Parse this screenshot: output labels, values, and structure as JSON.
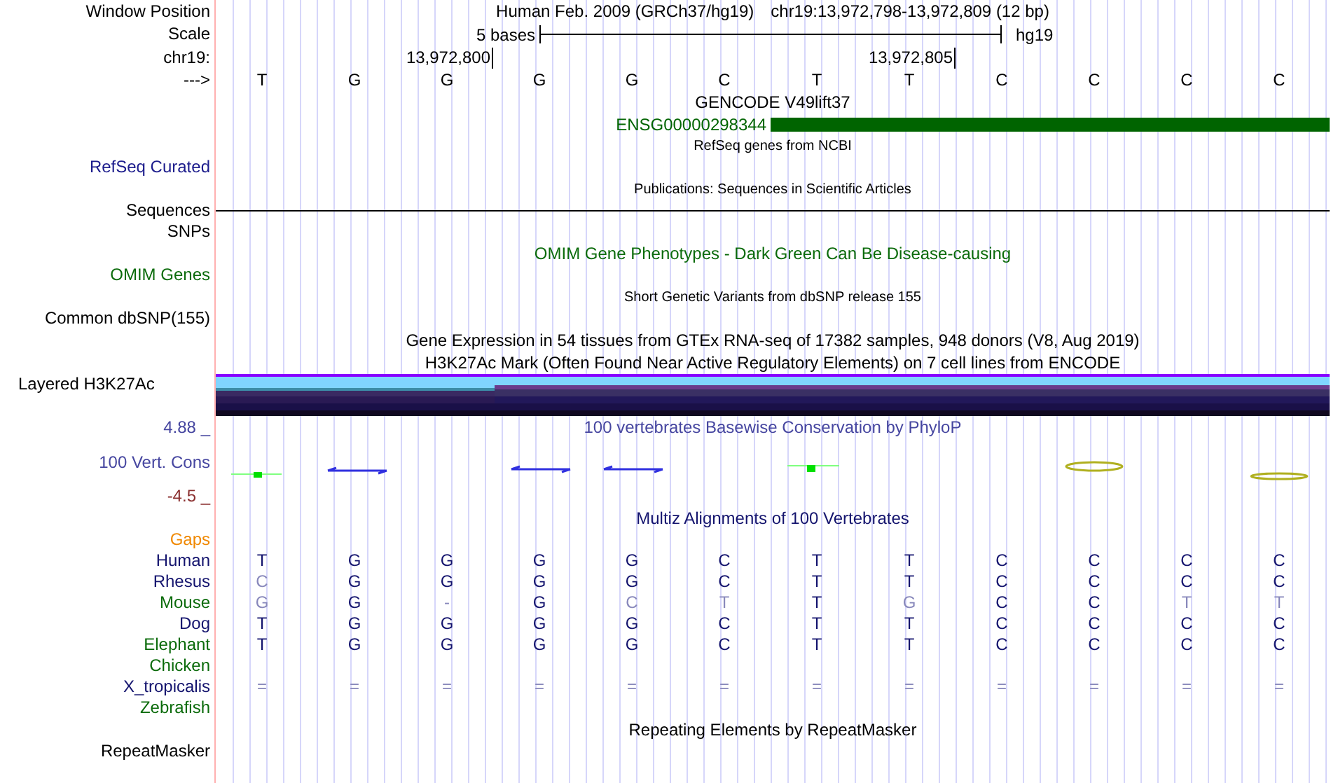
{
  "rows": [
    {
      "kind": "header",
      "label": "Window Position",
      "assembly": "Human Feb. 2009 (GRCh37/hg19)",
      "position": "chr19:13,972,798-13,972,809 (12 bp)"
    },
    {
      "kind": "scale",
      "label": "Scale",
      "span": "5 bases",
      "db": "hg19"
    },
    {
      "kind": "ruler",
      "label": "chr19:",
      "ticks": [
        "13,972,800",
        "13,972,805"
      ]
    },
    {
      "kind": "bases",
      "label": "--->",
      "bases": [
        "T",
        "G",
        "G",
        "G",
        "G",
        "C",
        "T",
        "T",
        "C",
        "C",
        "C",
        "C"
      ]
    },
    {
      "kind": "title",
      "text": "GENCODE V49lift37",
      "color": "#000000"
    },
    {
      "kind": "gene",
      "name": "ENSG00000298344",
      "color": "#006400"
    },
    {
      "kind": "small-title",
      "text": "RefSeq genes from NCBI"
    },
    {
      "kind": "label",
      "label": "RefSeq Curated",
      "color": "#1c1c8c"
    },
    {
      "kind": "small-title",
      "text": "Publications: Sequences in Scientific Articles"
    },
    {
      "kind": "rule",
      "label": "Sequences",
      "color": "#000000"
    },
    {
      "kind": "label",
      "label": "SNPs",
      "color": "#000000"
    },
    {
      "kind": "title",
      "text": "OMIM Gene Phenotypes - Dark Green Can Be Disease-causing",
      "color": "#0b6b0b"
    },
    {
      "kind": "label",
      "label": "OMIM Genes",
      "color": "#0b6b0b"
    },
    {
      "kind": "small-title",
      "text": "Short Genetic Variants from dbSNP release 155"
    },
    {
      "kind": "label",
      "label": "Common dbSNP(155)",
      "color": "#000000"
    },
    {
      "kind": "title",
      "text": "Gene Expression in 54 tissues from GTEx RNA-seq of 17382 samples, 948 donors (V8, Aug 2019)",
      "color": "#000000"
    },
    {
      "kind": "title",
      "text": "H3K27Ac Mark (Often Found Near Active Regulatory Elements) on 7 cell lines from ENCODE",
      "color": "#000000"
    },
    {
      "kind": "layered",
      "label": "Layered H3K27Ac",
      "color": "#000000"
    },
    {
      "kind": "title",
      "label": "4.88 _",
      "text": "100 vertebrates Basewise Conservation by PhyloP",
      "color": "#4646a0"
    },
    {
      "kind": "wiggle",
      "label": "100 Vert. Cons",
      "color": "#4646a0"
    },
    {
      "kind": "label",
      "label": "-4.5 _",
      "color": "#8b3030"
    },
    {
      "kind": "title",
      "text": "Multiz Alignments of 100 Vertebrates",
      "color": "#14146e"
    },
    {
      "kind": "label",
      "label": "Gaps",
      "color": "#f08800"
    },
    {
      "kind": "align",
      "label": "Human",
      "color": "#14146e",
      "bases": [
        {
          "text": "T",
          "dim": false
        },
        {
          "text": "G",
          "dim": false
        },
        {
          "text": "G",
          "dim": false
        },
        {
          "text": "G",
          "dim": false
        },
        {
          "text": "G",
          "dim": false
        },
        {
          "text": "C",
          "dim": false
        },
        {
          "text": "T",
          "dim": false
        },
        {
          "text": "T",
          "dim": false
        },
        {
          "text": "C",
          "dim": false
        },
        {
          "text": "C",
          "dim": false
        },
        {
          "text": "C",
          "dim": false
        },
        {
          "text": "C",
          "dim": false
        }
      ]
    },
    {
      "kind": "align",
      "label": "Rhesus",
      "color": "#14146e",
      "bases": [
        {
          "text": "C",
          "dim": true
        },
        {
          "text": "G",
          "dim": false
        },
        {
          "text": "G",
          "dim": false
        },
        {
          "text": "G",
          "dim": false
        },
        {
          "text": "G",
          "dim": false
        },
        {
          "text": "C",
          "dim": false
        },
        {
          "text": "T",
          "dim": false
        },
        {
          "text": "T",
          "dim": false
        },
        {
          "text": "C",
          "dim": false
        },
        {
          "text": "C",
          "dim": false
        },
        {
          "text": "C",
          "dim": false
        },
        {
          "text": "C",
          "dim": false
        }
      ]
    },
    {
      "kind": "align",
      "label": "Mouse",
      "color": "#0b6b0b",
      "bases": [
        {
          "text": "G",
          "dim": true
        },
        {
          "text": "G",
          "dim": false
        },
        {
          "text": "-",
          "dim": true
        },
        {
          "text": "G",
          "dim": false
        },
        {
          "text": "C",
          "dim": true
        },
        {
          "text": "T",
          "dim": true
        },
        {
          "text": "T",
          "dim": false
        },
        {
          "text": "G",
          "dim": true
        },
        {
          "text": "C",
          "dim": false
        },
        {
          "text": "C",
          "dim": false
        },
        {
          "text": "T",
          "dim": true
        },
        {
          "text": "T",
          "dim": true
        }
      ]
    },
    {
      "kind": "align",
      "label": "Dog",
      "color": "#14146e",
      "bases": [
        {
          "text": "T",
          "dim": false
        },
        {
          "text": "G",
          "dim": false
        },
        {
          "text": "G",
          "dim": false
        },
        {
          "text": "G",
          "dim": false
        },
        {
          "text": "G",
          "dim": false
        },
        {
          "text": "C",
          "dim": false
        },
        {
          "text": "T",
          "dim": false
        },
        {
          "text": "T",
          "dim": false
        },
        {
          "text": "C",
          "dim": false
        },
        {
          "text": "C",
          "dim": false
        },
        {
          "text": "C",
          "dim": false
        },
        {
          "text": "C",
          "dim": false
        }
      ]
    },
    {
      "kind": "align",
      "label": "Elephant",
      "color": "#0b6b0b",
      "bases": [
        {
          "text": "T",
          "dim": false
        },
        {
          "text": "G",
          "dim": false
        },
        {
          "text": "G",
          "dim": false
        },
        {
          "text": "G",
          "dim": false
        },
        {
          "text": "G",
          "dim": false
        },
        {
          "text": "C",
          "dim": false
        },
        {
          "text": "T",
          "dim": false
        },
        {
          "text": "T",
          "dim": false
        },
        {
          "text": "C",
          "dim": false
        },
        {
          "text": "C",
          "dim": false
        },
        {
          "text": "C",
          "dim": false
        },
        {
          "text": "C",
          "dim": false
        }
      ]
    },
    {
      "kind": "align",
      "label": "Chicken",
      "color": "#0b6b0b"
    },
    {
      "kind": "align",
      "label": "X_tropicalis",
      "color": "#14146e",
      "bases": [
        {
          "text": "=",
          "dim": true
        },
        {
          "text": "=",
          "dim": true
        },
        {
          "text": "=",
          "dim": true
        },
        {
          "text": "=",
          "dim": true
        },
        {
          "text": "=",
          "dim": true
        },
        {
          "text": "=",
          "dim": true
        },
        {
          "text": "=",
          "dim": true
        },
        {
          "text": "=",
          "dim": true
        },
        {
          "text": "=",
          "dim": true
        },
        {
          "text": "=",
          "dim": true
        },
        {
          "text": "=",
          "dim": true
        },
        {
          "text": "=",
          "dim": true
        }
      ]
    },
    {
      "kind": "align",
      "label": "Zebrafish",
      "color": "#0b6b0b"
    },
    {
      "kind": "title",
      "text": "Repeating Elements by RepeatMasker",
      "color": "#000000"
    },
    {
      "kind": "label",
      "label": "RepeatMasker",
      "color": "#000000"
    }
  ]
}
